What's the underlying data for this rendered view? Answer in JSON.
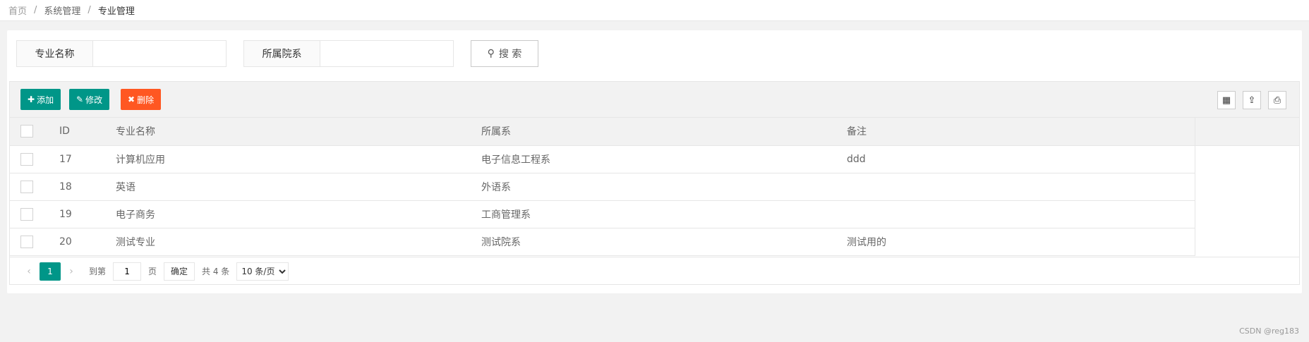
{
  "breadcrumb": [
    "首页",
    "系统管理",
    "专业管理"
  ],
  "search": {
    "fields": [
      {
        "label": "专业名称",
        "value": ""
      },
      {
        "label": "所属院系",
        "value": ""
      }
    ],
    "button_label": "搜 索"
  },
  "toolbar": {
    "add_label": "添加",
    "edit_label": "修改",
    "delete_label": "删除",
    "colors": {
      "primary": "#009688",
      "danger": "#ff5722"
    }
  },
  "table": {
    "headers": [
      "ID",
      "专业名称",
      "所属系",
      "备注"
    ],
    "rows": [
      {
        "id": "17",
        "name": "计算机应用",
        "dept": "电子信息工程系",
        "note": "ddd"
      },
      {
        "id": "18",
        "name": "英语",
        "dept": "外语系",
        "note": ""
      },
      {
        "id": "19",
        "name": "电子商务",
        "dept": "工商管理系",
        "note": ""
      },
      {
        "id": "20",
        "name": "测试专业",
        "dept": "测试院系",
        "note": "测试用的"
      }
    ]
  },
  "pager": {
    "prev_icon": "chevron-left-icon",
    "next_icon": "chevron-right-icon",
    "current_page": "1",
    "goto_label": "到第",
    "goto_value": "1",
    "page_label": "页",
    "confirm_label": "确定",
    "total_label": "共 4 条",
    "page_size": "10 条/页"
  },
  "watermark": "CSDN @reg183"
}
